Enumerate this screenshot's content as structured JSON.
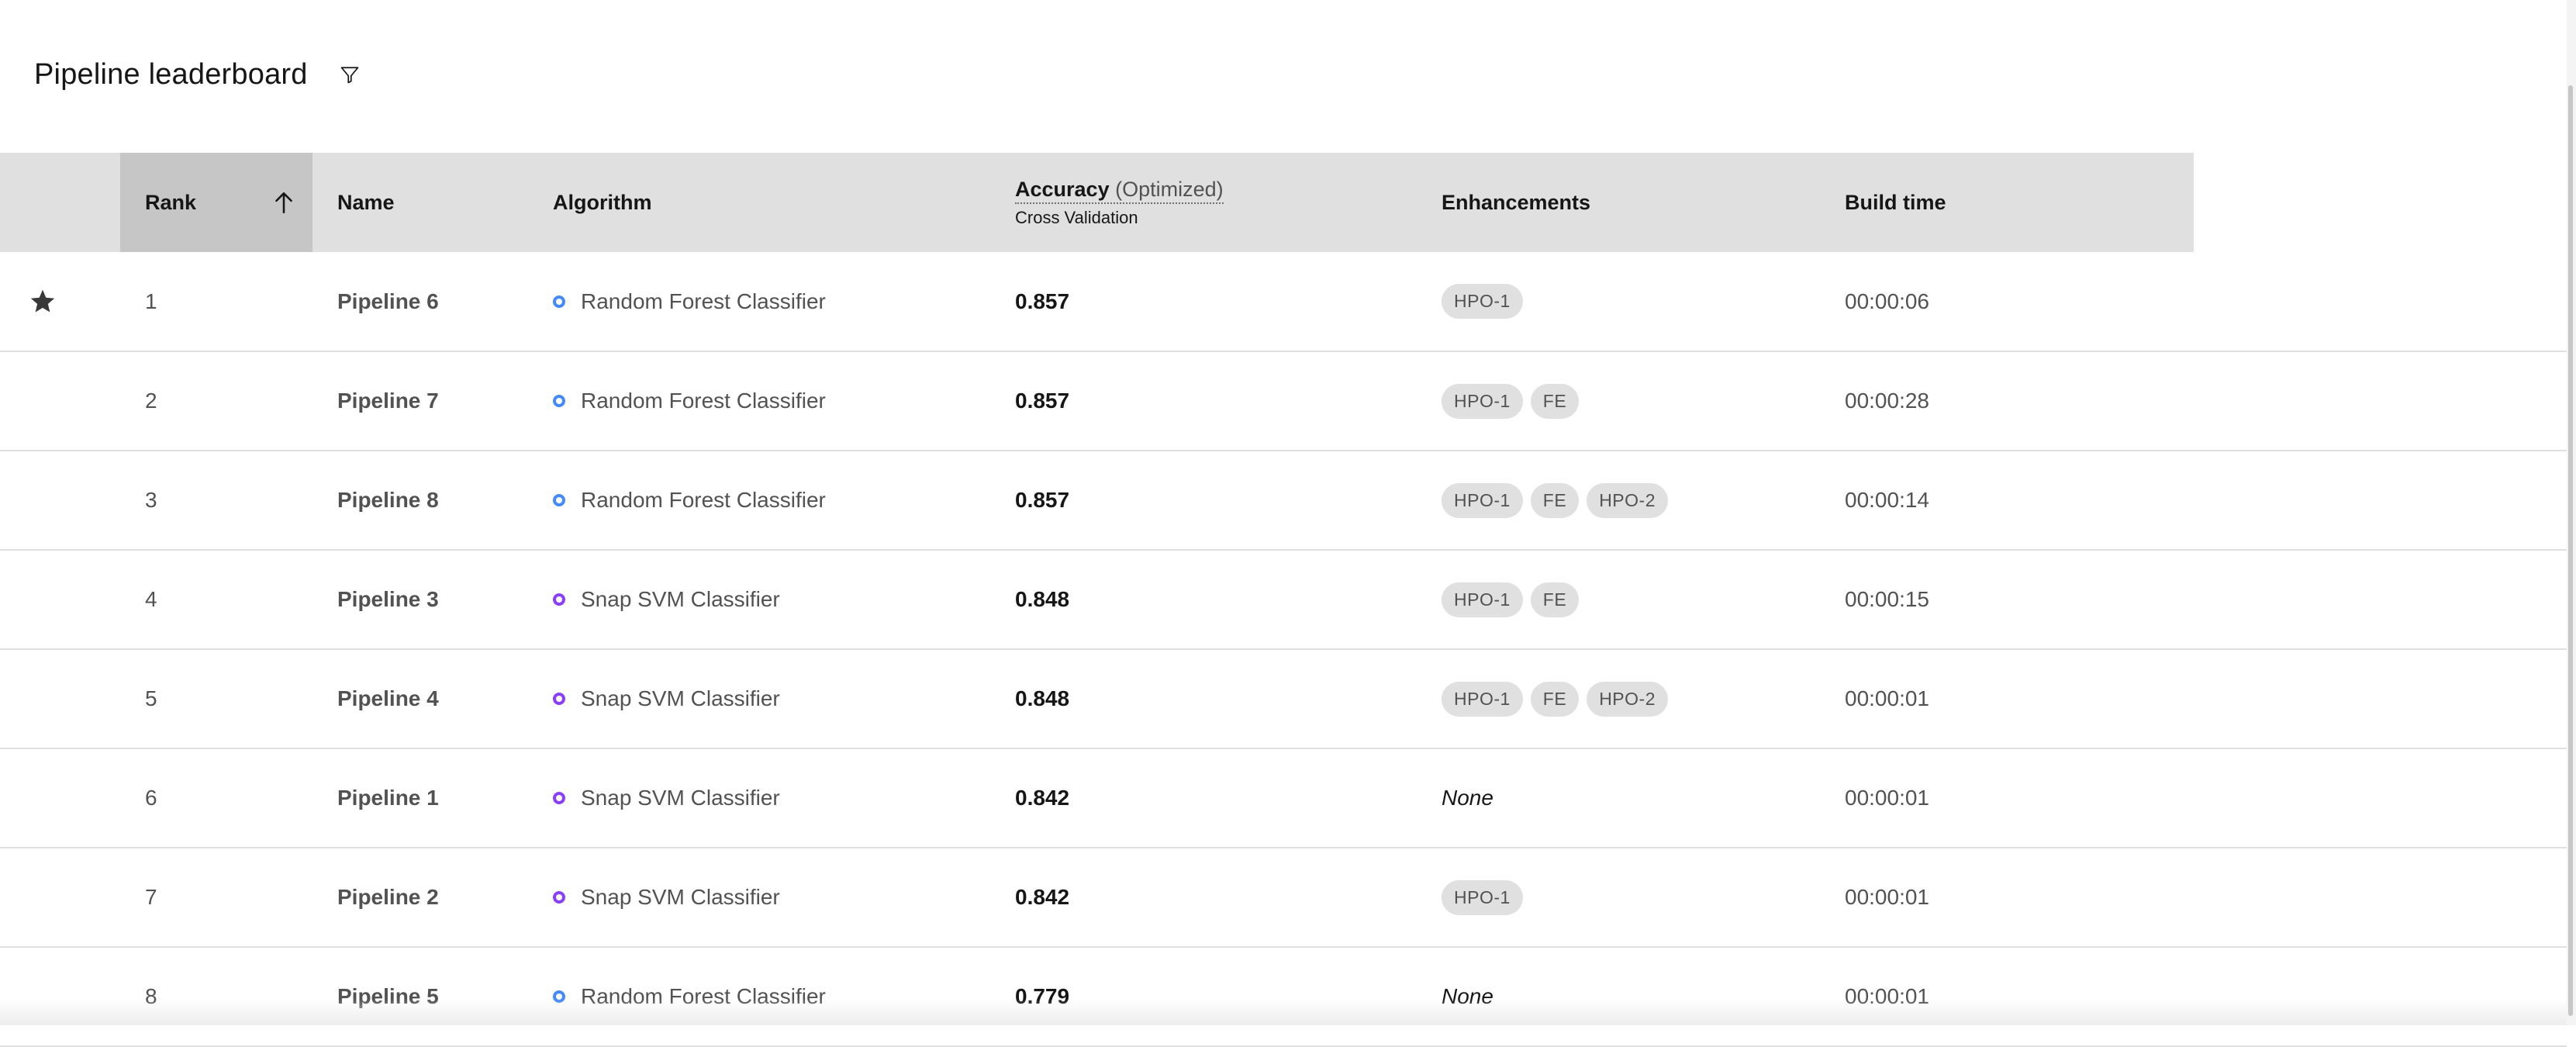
{
  "header": {
    "title": "Pipeline leaderboard",
    "filter_icon": "filter-icon"
  },
  "columns": {
    "rank": "Rank",
    "name": "Name",
    "algorithm": "Algorithm",
    "accuracy": "Accuracy",
    "accuracy_note": "(Optimized)",
    "accuracy_sub": "Cross Validation",
    "enhancements": "Enhancements",
    "build_time": "Build time"
  },
  "colors": {
    "random_forest_dot": "#4589ff",
    "snap_svm_dot": "#8a3ffc",
    "header_bg": "#e0e0e0",
    "sorted_header_bg": "#c6c6c6"
  },
  "rows": [
    {
      "starred": true,
      "rank": "1",
      "name": "Pipeline 6",
      "algo": "Random Forest Classifier",
      "algo_type": "rf",
      "accuracy": "0.857",
      "tags": [
        "HPO-1"
      ],
      "none": "",
      "time": "00:00:06"
    },
    {
      "starred": false,
      "rank": "2",
      "name": "Pipeline 7",
      "algo": "Random Forest Classifier",
      "algo_type": "rf",
      "accuracy": "0.857",
      "tags": [
        "HPO-1",
        "FE"
      ],
      "none": "",
      "time": "00:00:28"
    },
    {
      "starred": false,
      "rank": "3",
      "name": "Pipeline 8",
      "algo": "Random Forest Classifier",
      "algo_type": "rf",
      "accuracy": "0.857",
      "tags": [
        "HPO-1",
        "FE",
        "HPO-2"
      ],
      "none": "",
      "time": "00:00:14"
    },
    {
      "starred": false,
      "rank": "4",
      "name": "Pipeline 3",
      "algo": "Snap SVM Classifier",
      "algo_type": "snap",
      "accuracy": "0.848",
      "tags": [
        "HPO-1",
        "FE"
      ],
      "none": "",
      "time": "00:00:15"
    },
    {
      "starred": false,
      "rank": "5",
      "name": "Pipeline 4",
      "algo": "Snap SVM Classifier",
      "algo_type": "snap",
      "accuracy": "0.848",
      "tags": [
        "HPO-1",
        "FE",
        "HPO-2"
      ],
      "none": "",
      "time": "00:00:01"
    },
    {
      "starred": false,
      "rank": "6",
      "name": "Pipeline 1",
      "algo": "Snap SVM Classifier",
      "algo_type": "snap",
      "accuracy": "0.842",
      "tags": [],
      "none": "None",
      "time": "00:00:01"
    },
    {
      "starred": false,
      "rank": "7",
      "name": "Pipeline 2",
      "algo": "Snap SVM Classifier",
      "algo_type": "snap",
      "accuracy": "0.842",
      "tags": [
        "HPO-1"
      ],
      "none": "",
      "time": "00:00:01"
    },
    {
      "starred": false,
      "rank": "8",
      "name": "Pipeline 5",
      "algo": "Random Forest Classifier",
      "algo_type": "rf",
      "accuracy": "0.779",
      "tags": [],
      "none": "None",
      "time": "00:00:01"
    }
  ]
}
